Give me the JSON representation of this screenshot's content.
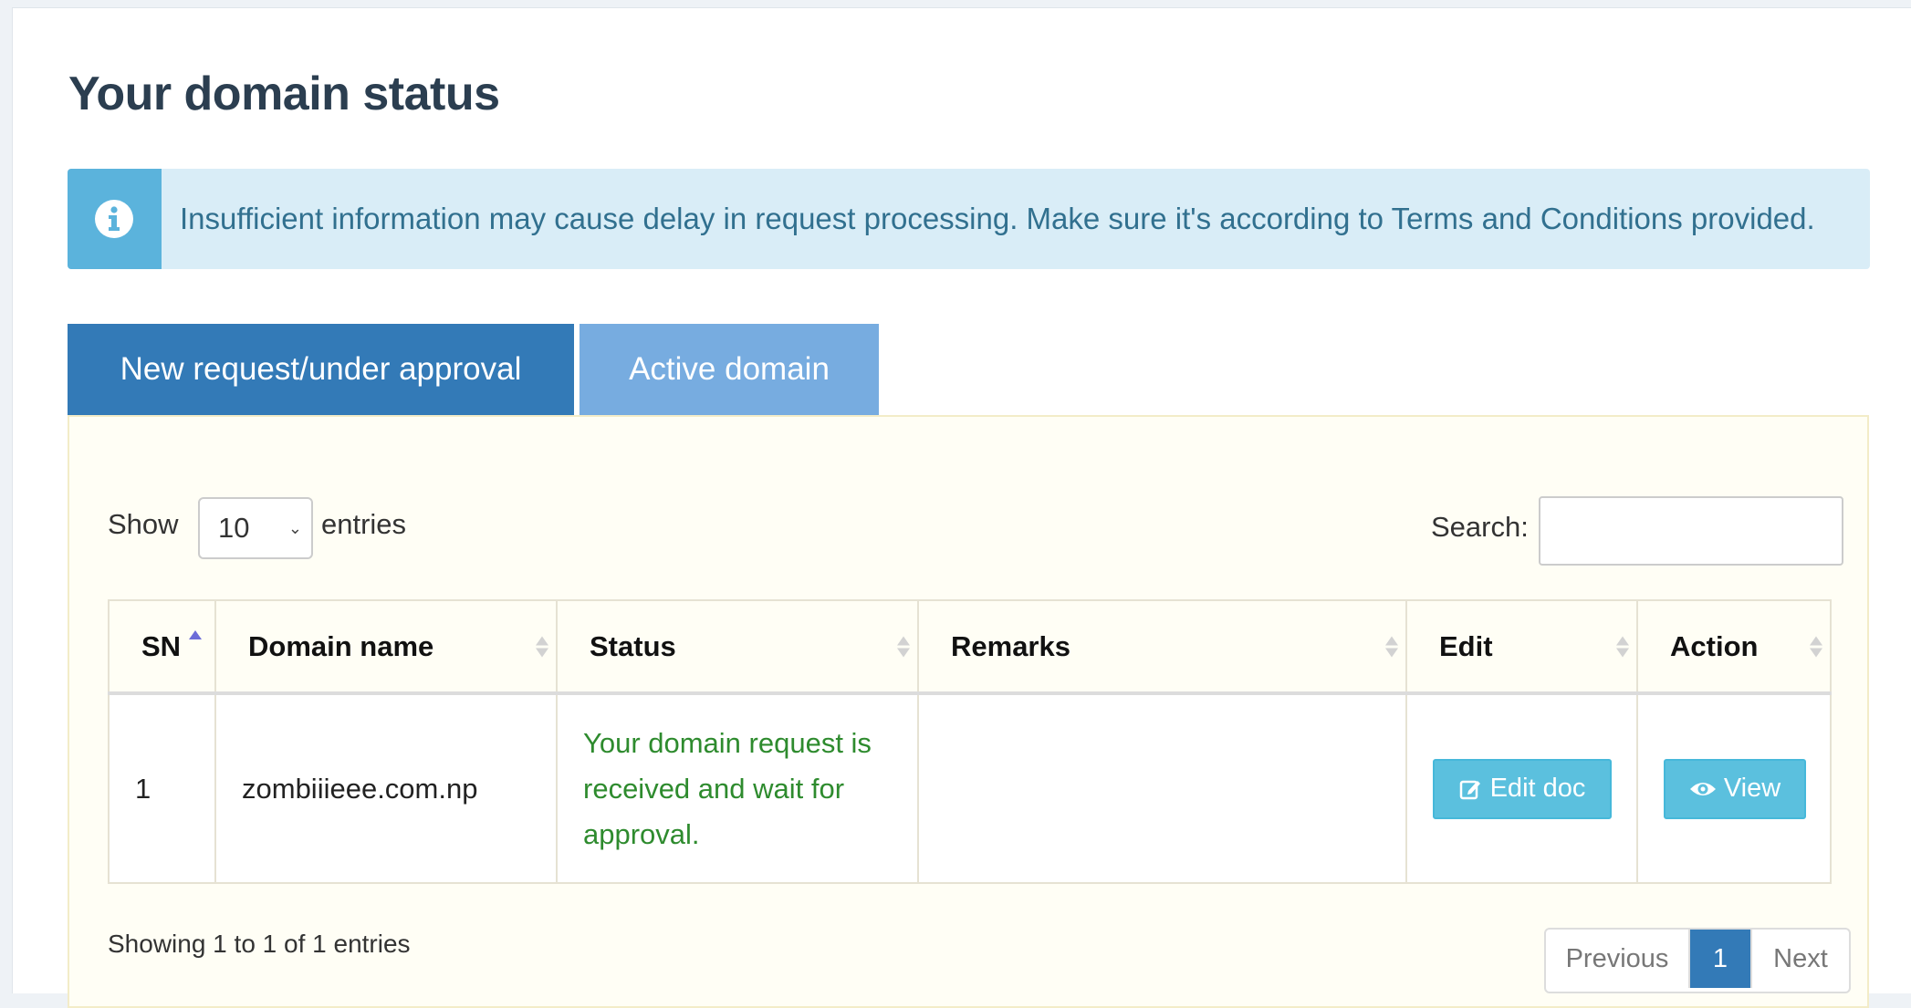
{
  "page": {
    "title": "Your domain status"
  },
  "alert": {
    "icon": "info-circle-icon",
    "message": "Insufficient information may cause delay in request processing. Make sure it's according to Terms and Conditions provided."
  },
  "tabs": [
    {
      "label": "New request/under approval",
      "active": true
    },
    {
      "label": "Active domain",
      "active": false
    }
  ],
  "table_controls": {
    "show_label": "Show",
    "page_length": "10",
    "entries_label": "entries",
    "search_label": "Search:",
    "search_value": ""
  },
  "table": {
    "columns": [
      "SN",
      "Domain name",
      "Status",
      "Remarks",
      "Edit",
      "Action"
    ],
    "rows": [
      {
        "sn": "1",
        "domain": "zombiiieee.com.np",
        "status": "Your domain request is received and wait for approval.",
        "remarks": "",
        "edit_label": "Edit doc",
        "action_label": "View"
      }
    ]
  },
  "footer": {
    "info": "Showing 1 to 1 of 1 entries",
    "pagination": {
      "previous": "Previous",
      "current": "1",
      "next": "Next"
    }
  },
  "colors": {
    "primary": "#337ab7",
    "tab_inactive": "#77ace0",
    "info_button": "#5bc0de",
    "alert_bg": "#d9edf7",
    "alert_text": "#31708f",
    "status_text": "#2e8b2e"
  }
}
